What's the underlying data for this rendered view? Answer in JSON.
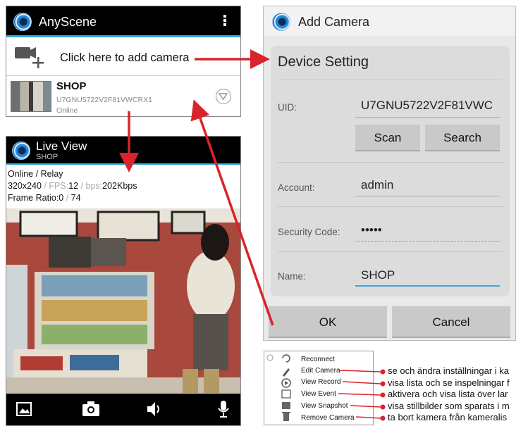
{
  "app_list": {
    "title": "AnyScene",
    "add_camera_label": "Click here to add camera",
    "camera": {
      "name": "SHOP",
      "uid": "U7GNU5722V2F81VWCRX1",
      "status": "Online"
    }
  },
  "live_view": {
    "title": "Live View",
    "subtitle": "SHOP",
    "status": "Online",
    "mode": "Relay",
    "resolution": "320x240",
    "fps_label": "FPS:",
    "fps": "12",
    "bps_label": "bps:",
    "bps": "202Kbps",
    "frame_ratio_label": "Frame Ratio:",
    "frame_ratio_a": "0",
    "frame_ratio_b": "74"
  },
  "add_camera": {
    "title": "Add Camera",
    "section": "Device Setting",
    "uid_label": "UID:",
    "uid_value": "U7GNU5722V2F81VWC",
    "scan": "Scan",
    "search": "Search",
    "account_label": "Account:",
    "account_value": "admin",
    "security_label": "Security Code:",
    "security_value": "•••••",
    "name_label": "Name:",
    "name_value": "SHOP",
    "ok": "OK",
    "cancel": "Cancel"
  },
  "context_menu": {
    "items": [
      "Reconnect",
      "Edit Camera",
      "View Record",
      "View Event",
      "View Snapshot",
      "Remove Camera"
    ]
  },
  "annotations": [
    "se och ändra inställningar i ka",
    "visa lista och se inspelningar f",
    "aktivera och visa lista över lar",
    "visa stillbilder som sparats i m",
    "ta bort kamera från kameralis"
  ],
  "colors": {
    "accent": "#36a8e0",
    "arrow": "#d9232a",
    "app_bar": "#000000"
  }
}
